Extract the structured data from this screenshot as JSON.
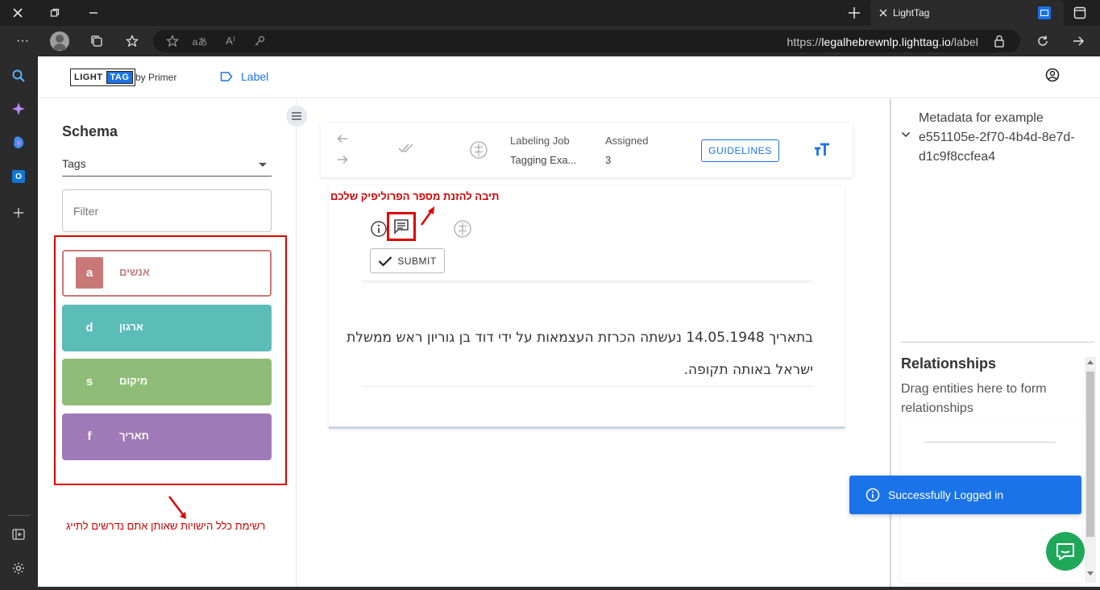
{
  "browser": {
    "tab_title": "LightTag",
    "url_prefix": "https://",
    "url_host": "legalhebrewnlp.lighttag.io",
    "url_path": "/label"
  },
  "header": {
    "logo_light": "LIGHT",
    "logo_tag": "TAG",
    "logo_by": "by Primer",
    "nav_label": "Label"
  },
  "sidebar": {
    "title": "Schema",
    "select_value": "Tags",
    "filter_placeholder": "Filter",
    "tags": [
      {
        "key": "a",
        "name": "אנשים",
        "color": "#c97878"
      },
      {
        "key": "d",
        "name": "ארגון",
        "color": "#5bbcb8"
      },
      {
        "key": "s",
        "name": "מיקום",
        "color": "#8fbd78"
      },
      {
        "key": "f",
        "name": "תאריך",
        "color": "#a07ab8"
      }
    ],
    "annotation_note": "רשימת כלל הישויות שאותן אתם נדרשים לתייג"
  },
  "toolbar": {
    "labeling_job_label": "Labeling Job",
    "labeling_job_value": "Tagging Exa...",
    "assigned_label": "Assigned",
    "assigned_value": "3",
    "guidelines_label": "GUIDELINES"
  },
  "document": {
    "annotation_note": "תיבה להזנת מספר הפרוליפיק שלכם",
    "submit_label": "SUBMIT",
    "line1": "בתאריך 14.05.1948 נעשתה הכרזת העצמאות על ידי דוד בן גוריון ראש ממשלת",
    "line2": "ישראל באותה תקופה."
  },
  "right_panel": {
    "metadata_text": "Metadata for example e551105e-2f70-4b4d-8e7d-d1c9f8ccfea4",
    "relationships_title": "Relationships",
    "relationships_desc": "Drag entities here to form relationships"
  },
  "toast": {
    "message": "Successfully Logged in"
  }
}
